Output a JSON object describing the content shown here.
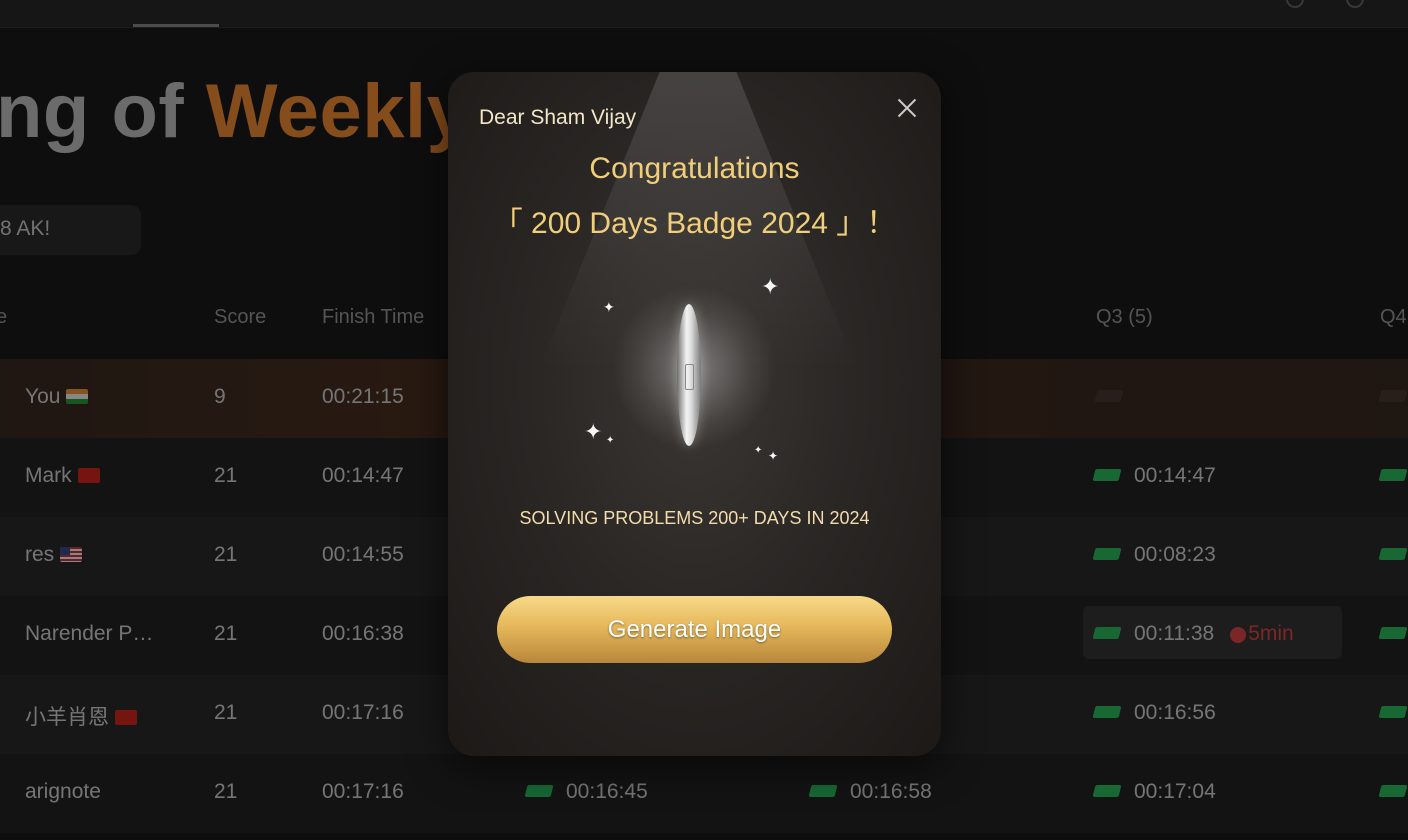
{
  "page": {
    "title_plain": "ng of ",
    "title_accent": "Weekly",
    "ak_pill": "8 AK!"
  },
  "table": {
    "headers": [
      "e",
      "Score",
      "Finish Time",
      "Q3 (5)",
      "Q4"
    ],
    "rows": [
      {
        "name": "You",
        "flag": "in",
        "score": "9",
        "finish": "00:21:15",
        "q1": "",
        "q2": "",
        "q3": "",
        "q3_status": "empty"
      },
      {
        "name": "Mark",
        "flag": "cn",
        "score": "21",
        "finish": "00:14:47",
        "q1": "",
        "q2": "",
        "q3": "00:14:47",
        "q3_status": "ac"
      },
      {
        "name": "res",
        "flag": "us",
        "score": "21",
        "finish": "00:14:55",
        "q1": "",
        "q2": "",
        "q3": "00:08:23",
        "q3_status": "ac"
      },
      {
        "name": "Narender P…",
        "flag": "",
        "score": "21",
        "finish": "00:16:38",
        "q1": "",
        "q2": "",
        "q3": "00:11:38",
        "q3_status": "ac",
        "penalty": "5min"
      },
      {
        "name": "小羊肖恩",
        "flag": "cn",
        "score": "21",
        "finish": "00:17:16",
        "q1": "",
        "q2": "",
        "q3": "00:16:56",
        "q3_status": "ac"
      },
      {
        "name": "arignote",
        "flag": "",
        "score": "21",
        "finish": "00:17:16",
        "q1": "00:16:45",
        "q2": "00:16:58",
        "q3": "00:17:04",
        "q3_status": "ac"
      }
    ]
  },
  "modal": {
    "greeting": "Dear Sham Vijay",
    "congrats": "Congratulations",
    "badge_name": "「 200 Days Badge 2024 」！",
    "caption": "SOLVING PROBLEMS 200+ DAYS IN 2024",
    "button_label": "Generate Image",
    "close_icon": "close-icon"
  },
  "colors": {
    "accent_orange": "#f28a34",
    "gold_text": "#f1cf7a",
    "accepted_green": "#2bbd5e",
    "penalty_red": "#e04848"
  }
}
